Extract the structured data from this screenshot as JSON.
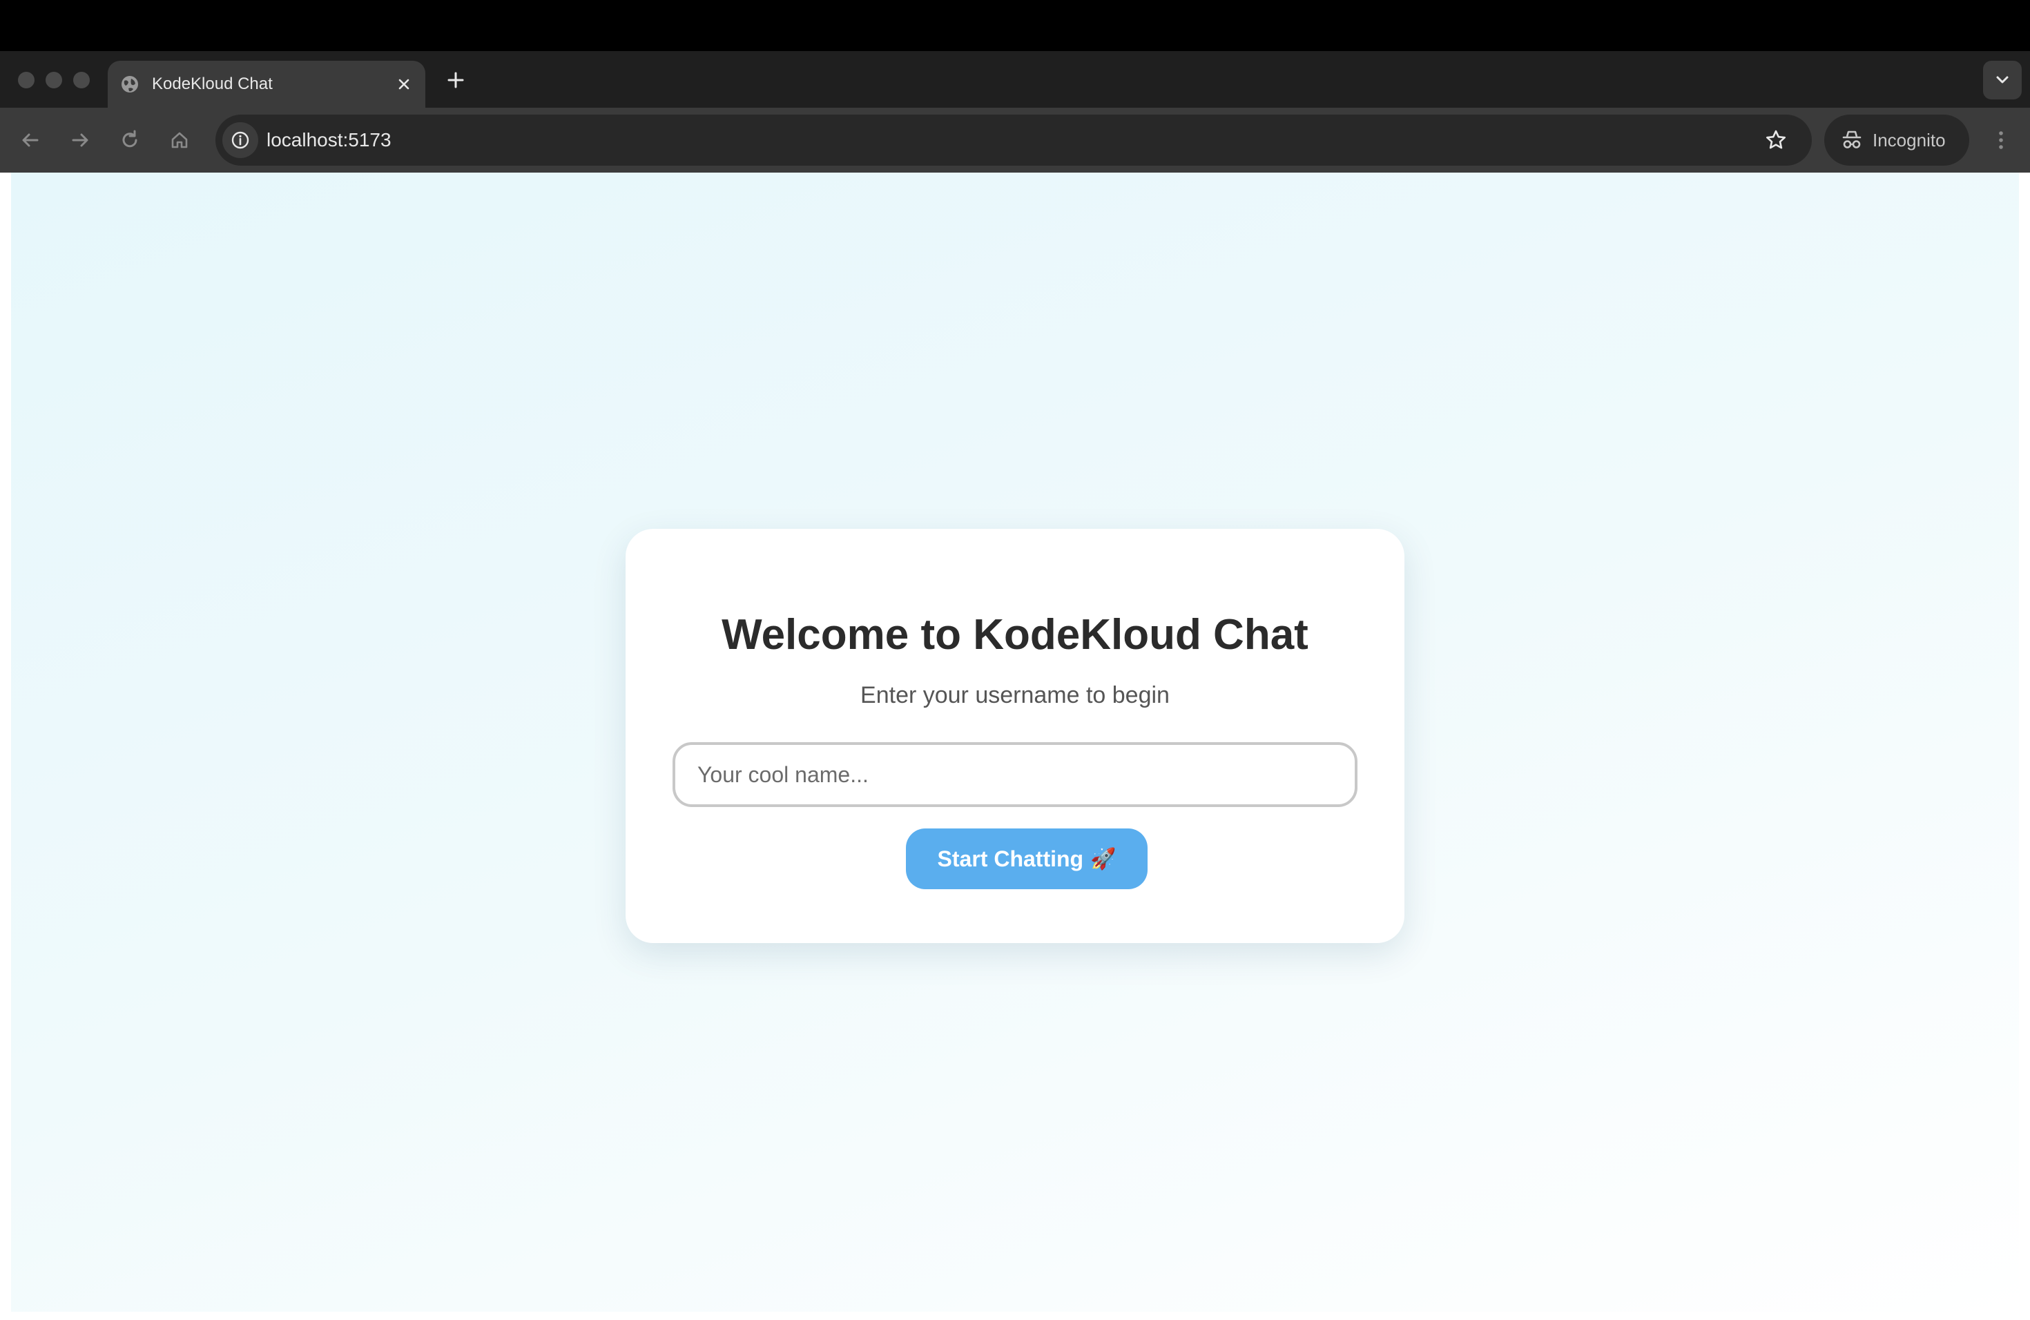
{
  "browser": {
    "tab_title": "KodeKloud Chat",
    "url": "localhost:5173",
    "incognito_label": "Incognito"
  },
  "icons": {
    "tab_favicon": "globe-icon",
    "close": "close-icon",
    "new_tab": "plus-icon",
    "tab_search": "chevron-down-icon",
    "back": "arrow-left-icon",
    "forward": "arrow-right-icon",
    "reload": "reload-icon",
    "home": "home-icon",
    "site_info": "info-icon",
    "bookmark": "star-icon",
    "incognito": "incognito-icon",
    "menu": "kebab-menu-icon"
  },
  "login": {
    "title": "Welcome to KodeKloud Chat",
    "subtitle": "Enter your username to begin",
    "input_placeholder": "Your cool name...",
    "input_value": "",
    "button_label": "Start Chatting",
    "button_emoji": "🚀"
  },
  "colors": {
    "chrome_dark": "#1f1f1f",
    "toolbar": "#3b3b3b",
    "button_accent": "#5aaeee",
    "page_bg_start": "#e6f7fb",
    "title_text": "#2b2b2b"
  }
}
